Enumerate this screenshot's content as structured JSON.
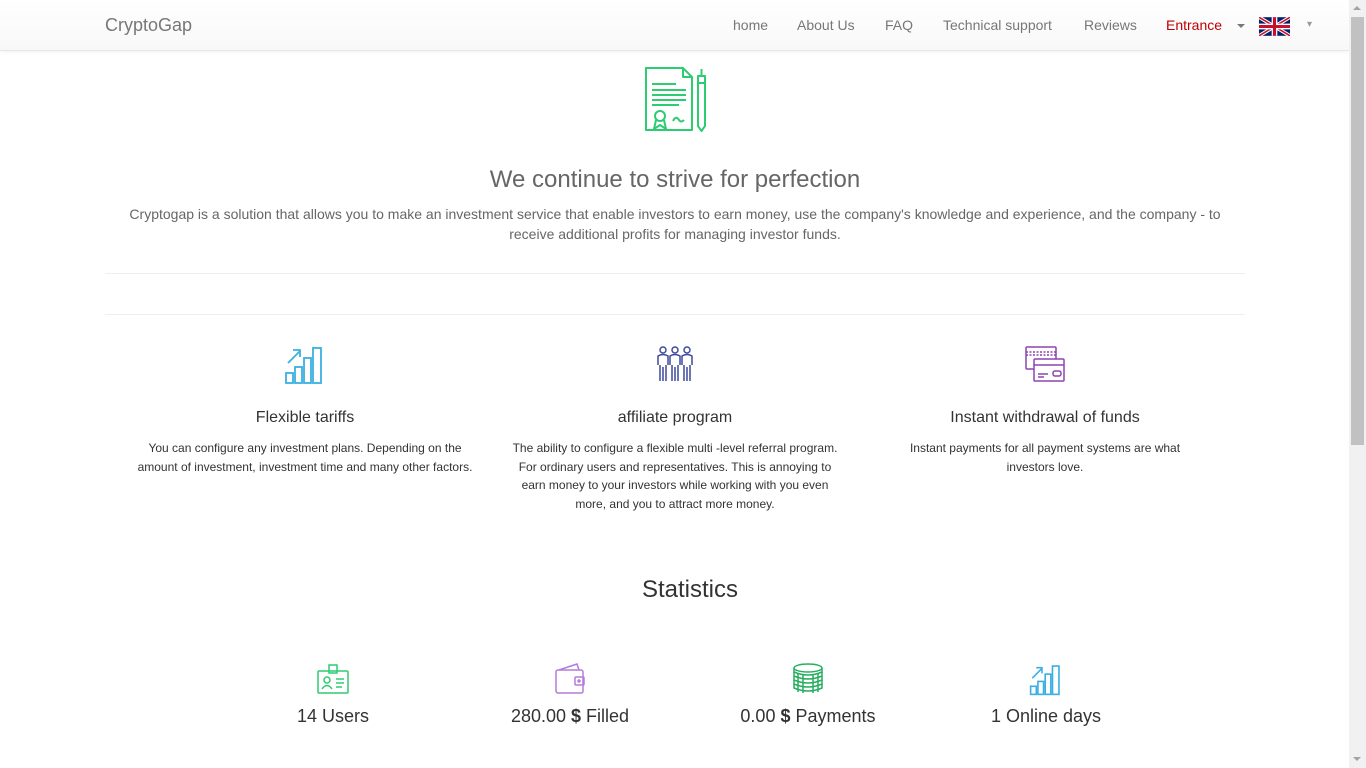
{
  "navbar": {
    "brand": "CryptoGap",
    "links": [
      {
        "label": "home"
      },
      {
        "label": "About Us"
      },
      {
        "label": "FAQ"
      },
      {
        "label": "Technical support"
      },
      {
        "label": "Reviews"
      }
    ],
    "entrance": "Entrance",
    "language_icon": "uk-flag-icon",
    "language_caret": "▾"
  },
  "hero": {
    "icon": "certificate-pen-icon",
    "title": "We continue to strive for perfection",
    "text": "Cryptogap is a solution that allows you to make an investment service that enable investors to earn money, use the company's knowledge and experience, and the company - to receive additional profits for managing investor funds."
  },
  "features": [
    {
      "icon": "growth-chart-icon",
      "title": "Flexible tariffs",
      "text": "You can configure any investment plans. Depending on the amount of investment, investment time and many other factors."
    },
    {
      "icon": "people-group-icon",
      "title": "affiliate program",
      "text": "The ability to configure a flexible multi -level referral program. For ordinary users and representatives. This is annoying to earn money to your investors while working with you even more, and you to attract more money."
    },
    {
      "icon": "credit-cards-icon",
      "title": "Instant withdrawal of funds",
      "text": "Instant payments for all payment systems are what investors love."
    }
  ],
  "statistics": {
    "title": "Statistics",
    "items": [
      {
        "icon": "id-badge-icon",
        "value": "14",
        "currency": "",
        "label": "Users"
      },
      {
        "icon": "wallet-icon",
        "value": "280.00",
        "currency": "$",
        "label": "Filled"
      },
      {
        "icon": "coin-stack-icon",
        "value": "0.00",
        "currency": "$",
        "label": "Payments"
      },
      {
        "icon": "growth-chart-icon",
        "value": "1",
        "currency": "",
        "label": "Online days"
      }
    ]
  },
  "colors": {
    "entrance": "#c00000",
    "green_icon": "#2ecc71",
    "blue_icon": "#3ab0e2",
    "indigo_icon": "#3f4a9e",
    "purple_icon": "#8e44ad"
  }
}
